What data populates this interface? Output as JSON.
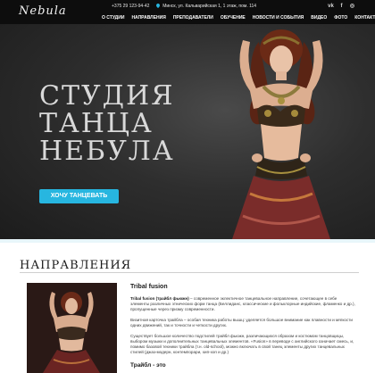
{
  "header": {
    "logo": "Nebula",
    "phone": "+375 29 123-94-42",
    "address": "Минск, ул. Кальварийская 1, 1 этаж, пом. 114",
    "social": [
      "vk",
      "fb",
      "ig"
    ]
  },
  "nav": {
    "items": [
      {
        "label": "О СТУДИИ"
      },
      {
        "label": "НАПРАВЛЕНИЯ"
      },
      {
        "label": "ПРЕПОДАВАТЕЛИ"
      },
      {
        "label": "ОБУЧЕНИЕ"
      },
      {
        "label": "НОВОСТИ И СОБЫТИЯ"
      },
      {
        "label": "ВИДЕО"
      },
      {
        "label": "ФОТО"
      },
      {
        "label": "КОНТАКТЫ"
      }
    ]
  },
  "hero": {
    "title_line1": "СТУДИЯ",
    "title_line2": "ТАНЦА",
    "title_line3": "НЕБУЛА",
    "cta_label": "ХОЧУ ТАНЦЕВАТЬ"
  },
  "directions": {
    "section_title": "НАПРАВЛЕНИЯ",
    "heading": "Tribal fusion",
    "p1_bold": "Tribal fusion (трайбл фьюжн)",
    "p1_rest": " – современное эклектичное танцевальное направление, сочетающее в себе элементы различных этнических форм танца (Беллиданс, классические и фольклорные индийские, фламенко и др.), пропущенные через призму современности.",
    "p2": "Визитная карточка трайбла – особая техника работы вышц: уделяется большое внимание как плавности и мягкости одних движений, так и точности и четкости других.",
    "p3": "Существует большое количество подстилей трайбл фьюжн, различающихся образом и костюмом танцовщицы, выбором музыки и дополнительных танцевальных элементов. «Fusion» в переводе с английского означает смесь, и, помимо базовой техники трайбла (т.н. old-school), можно включать в свой танец элементы других танцевальных стилей (джаз-модерн, контемпорари, хип-хоп и др.)",
    "subheading": "Трайбл - это"
  },
  "colors": {
    "accent": "#27b6e0",
    "topbar": "#0d0d0d"
  }
}
